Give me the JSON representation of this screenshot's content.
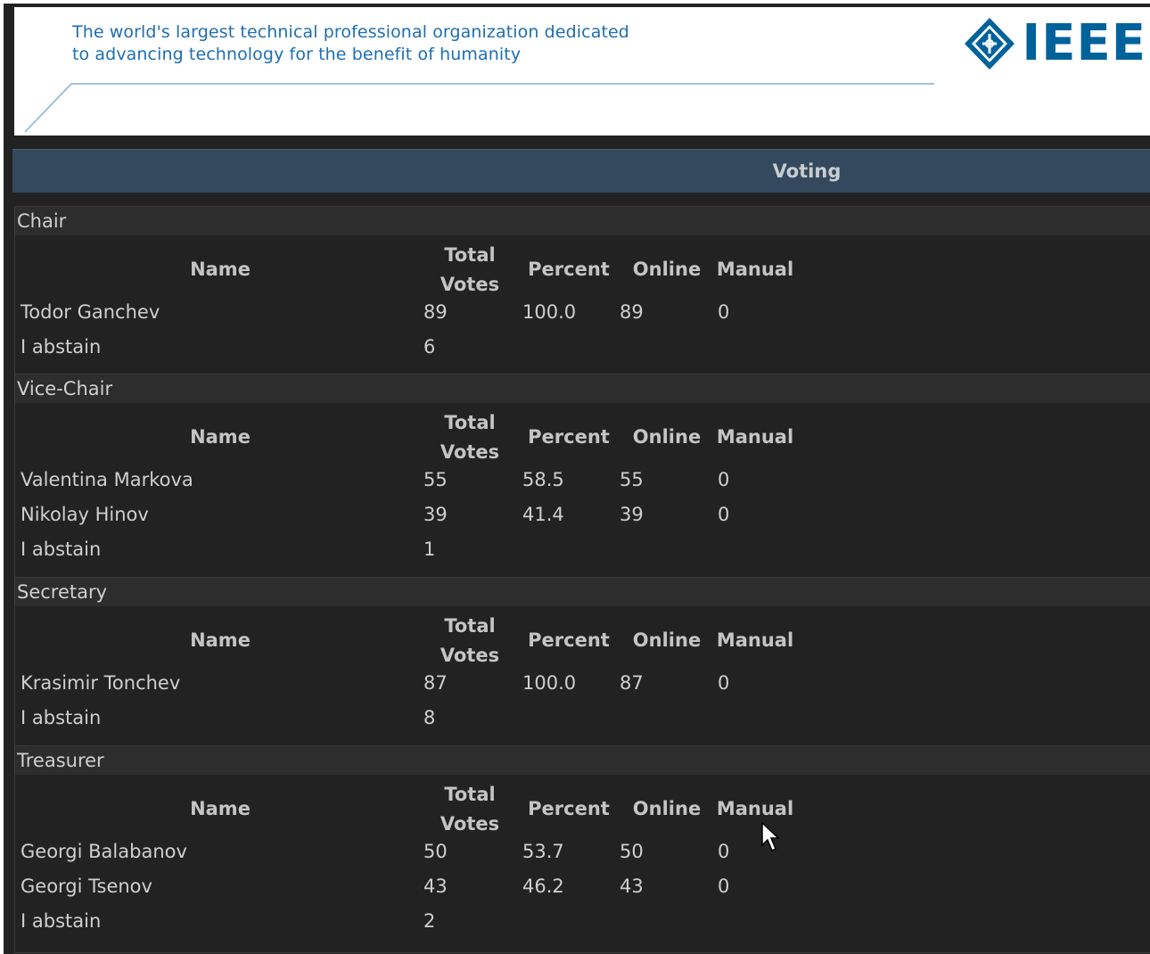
{
  "banner": {
    "tagline_line1": "The world's largest technical professional organization dedicated",
    "tagline_line2": "to advancing technology for the benefit of humanity",
    "logo_text": "IEEE",
    "brand_color": "#00629b",
    "tagline_color": "#1d6fb0"
  },
  "voting": {
    "title": "Voting"
  },
  "columns": {
    "name": "Name",
    "total_votes_line1": "Total",
    "total_votes_line2": "Votes",
    "percent": "Percent",
    "online": "Online",
    "manual": "Manual"
  },
  "sections": [
    {
      "title": "Chair",
      "rows": [
        {
          "name": "Todor Ganchev",
          "total": "89",
          "percent": "100.0",
          "online": "89",
          "manual": "0"
        },
        {
          "name": "I abstain",
          "total": "6",
          "percent": "",
          "online": "",
          "manual": ""
        }
      ]
    },
    {
      "title": "Vice-Chair",
      "rows": [
        {
          "name": "Valentina Markova",
          "total": "55",
          "percent": "58.5",
          "online": "55",
          "manual": "0"
        },
        {
          "name": "Nikolay Hinov",
          "total": "39",
          "percent": "41.4",
          "online": "39",
          "manual": "0"
        },
        {
          "name": "I abstain",
          "total": "1",
          "percent": "",
          "online": "",
          "manual": ""
        }
      ]
    },
    {
      "title": "Secretary",
      "rows": [
        {
          "name": "Krasimir Tonchev",
          "total": "87",
          "percent": "100.0",
          "online": "87",
          "manual": "0"
        },
        {
          "name": "I abstain",
          "total": "8",
          "percent": "",
          "online": "",
          "manual": ""
        }
      ]
    },
    {
      "title": "Treasurer",
      "rows": [
        {
          "name": "Georgi Balabanov",
          "total": "50",
          "percent": "53.7",
          "online": "50",
          "manual": "0"
        },
        {
          "name": "Georgi Tsenov",
          "total": "43",
          "percent": "46.2",
          "online": "43",
          "manual": "0"
        },
        {
          "name": "I abstain",
          "total": "2",
          "percent": "",
          "online": "",
          "manual": ""
        }
      ]
    }
  ]
}
